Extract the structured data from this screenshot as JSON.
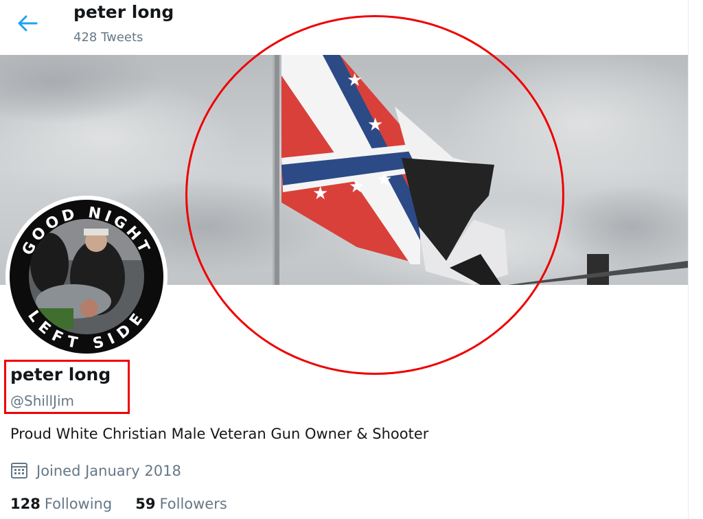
{
  "header": {
    "title": "peter long",
    "tweet_count": "428 Tweets"
  },
  "avatar": {
    "text_top": "GOOD NIGHT",
    "text_bottom": "LEFT SIDE"
  },
  "profile": {
    "name": "peter long",
    "handle": "@ShillJim",
    "bio": "Proud White Christian Male Veteran Gun Owner & Shooter",
    "joined": "Joined January 2018",
    "following_count": "128",
    "following_label": "Following",
    "followers_count": "59",
    "followers_label": "Followers"
  },
  "colors": {
    "accent": "#1da1f2",
    "annotation": "#ee0000",
    "secondary_text": "#657786"
  },
  "icons": {
    "back": "arrow-left-icon",
    "joined": "calendar-icon"
  }
}
